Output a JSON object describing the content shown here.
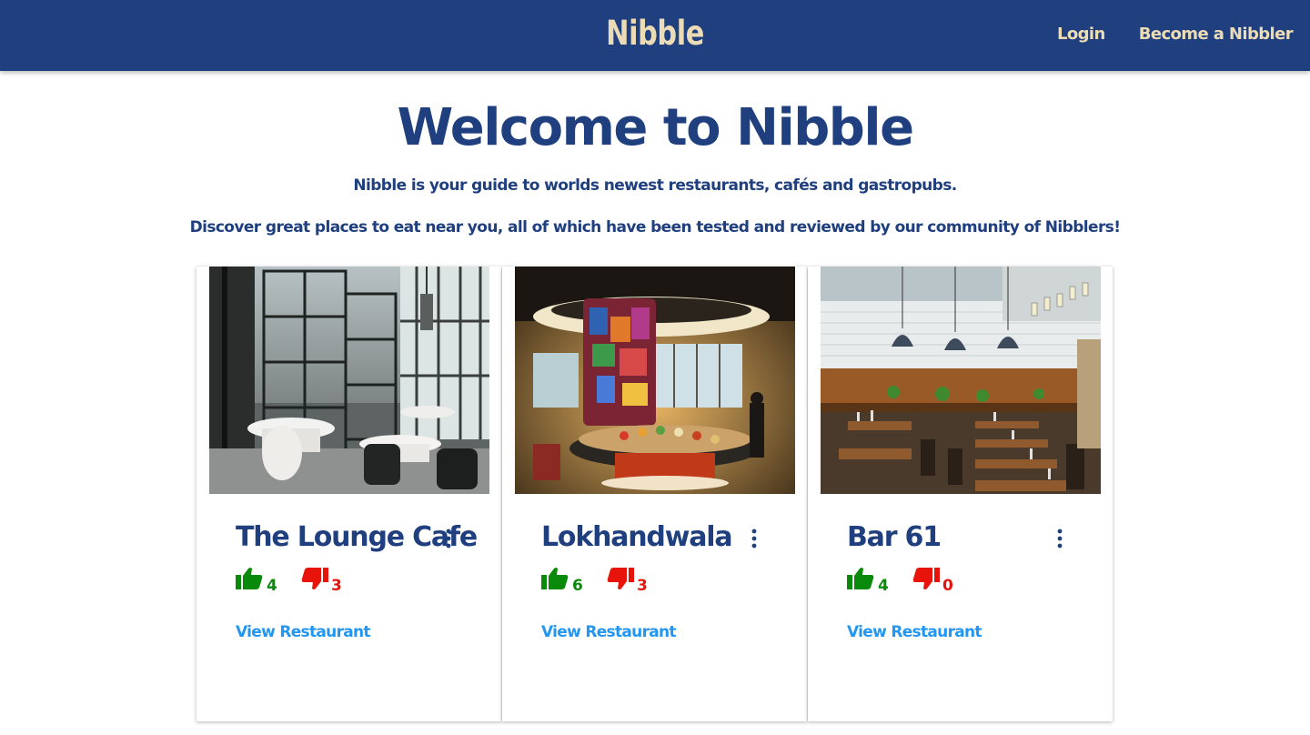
{
  "navbar": {
    "brand": "Nibble",
    "links": [
      "Login",
      "Become a Nibbler"
    ]
  },
  "hero": {
    "title": "Welcome to Nibble",
    "line1": "Nibble is your guide to worlds newest restaurants, cafés and gastropubs.",
    "line2": "Discover great places to eat near you, all of which have been tested and reviewed by our community of Nibblers!"
  },
  "restaurants": [
    {
      "name": "The Lounge Cafe",
      "thumbs_up": "4",
      "thumbs_down": "3",
      "link": "View Restaurant"
    },
    {
      "name": "Lokhandwala",
      "thumbs_up": "6",
      "thumbs_down": "3",
      "link": "View Restaurant"
    },
    {
      "name": "Bar 61",
      "thumbs_up": "4",
      "thumbs_down": "0",
      "link": "View Restaurant"
    }
  ],
  "colors": {
    "primary": "#1f3f7f",
    "accent": "#ecdcb5",
    "thumbs_up": "#0a8a0a",
    "thumbs_down": "#e8140c",
    "link": "#2196f3"
  }
}
